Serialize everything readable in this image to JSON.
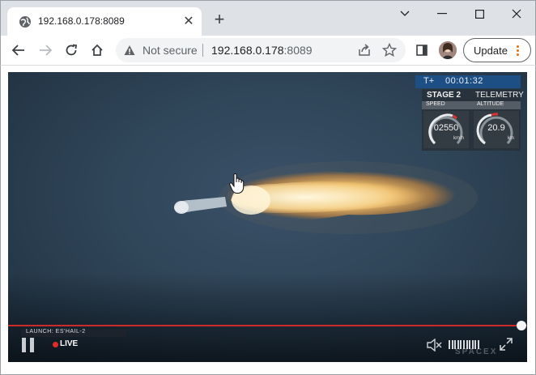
{
  "tab": {
    "title": "192.168.0.178:8089"
  },
  "toolbar": {
    "security_label": "Not secure",
    "url_host": "192.168.0.178",
    "url_port": ":8089",
    "update_label": "Update"
  },
  "video": {
    "telemetry": {
      "timer_prefix": "T+",
      "timer": "00:01:32",
      "stage": "STAGE 2",
      "title": "TELEMETRY",
      "speed_label": "SPEED",
      "altitude_label": "ALTITUDE",
      "speed_value": "02550",
      "speed_unit": "km/h",
      "altitude_value": "20.9",
      "altitude_unit": "km"
    },
    "launch_label": "LAUNCH: ES'HAIL-2",
    "live_label": "LIVE",
    "brand": "SPACEX",
    "progress_fraction": 0.98
  },
  "colors": {
    "progress": "#cf2a2a",
    "timer_bar": "#1d4e84",
    "live_dot": "#e22a2a",
    "menu_dots": "#e8710a"
  }
}
